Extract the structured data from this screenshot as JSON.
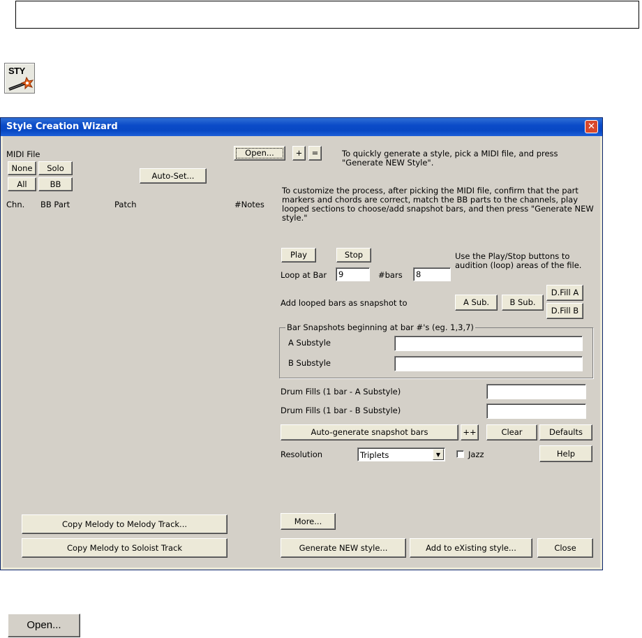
{
  "top_field": {
    "value": ""
  },
  "sty_button": {
    "label": "STY"
  },
  "window": {
    "title": "Style Creation Wizard",
    "close_glyph": "✕"
  },
  "left": {
    "midi_file_label": "MIDI File",
    "none_label": "None",
    "solo_label": "Solo",
    "all_label": "All",
    "bb_label": "BB",
    "auto_set_label": "Auto-Set...",
    "columns": [
      "Chn.",
      "BB Part",
      "Patch",
      "#Notes"
    ],
    "copy_melody_label": "Copy Melody to Melody Track...",
    "copy_soloist_label": "Copy Melody to Soloist Track"
  },
  "right": {
    "open_label": "Open...",
    "plus_label": "+",
    "equals_label": "=",
    "intro_text": "To quickly generate a style, pick a MIDI file, and press \"Generate NEW Style\".",
    "customize_text": "To customize the process, after picking the MIDI file, confirm that the part markers and chords are correct, match the BB parts to the channels, play looped sections to choose/add snapshot bars, and then press \"Generate NEW style.\"",
    "play_label": "Play",
    "stop_label": "Stop",
    "play_help": "Use the Play/Stop buttons to audition (loop) areas of the file.",
    "loop_at_bar_label": "Loop at Bar",
    "loop_at_bar_value": "9",
    "bars_label": "#bars",
    "bars_value": "8",
    "add_looped_label": "Add  looped bars as snapshot to",
    "a_sub_label": "A Sub.",
    "b_sub_label": "B Sub.",
    "dfill_a_label": "D.Fill A",
    "dfill_b_label": "D.Fill B",
    "snapshots_group_caption": "Bar Snapshots beginning at bar #'s (eg. 1,3,7)",
    "a_substyle_label": "A Substyle",
    "a_substyle_value": "",
    "b_substyle_label": "B Substyle",
    "b_substyle_value": "",
    "drum_fills_a_label": "Drum Fills (1 bar - A Substyle)",
    "drum_fills_a_value": "",
    "drum_fills_b_label": "Drum Fills (1 bar - B Substyle)",
    "drum_fills_b_value": "",
    "auto_generate_label": "Auto-generate snapshot bars",
    "plusplus_label": "++",
    "clear_label": "Clear",
    "defaults_label": "Defaults",
    "resolution_label": "Resolution",
    "resolution_value": "Triplets",
    "jazz_label": "Jazz",
    "help_label": "Help",
    "more_label": "More...",
    "generate_new_label": "Generate NEW style...",
    "add_existing_label": "Add to eXisting style...",
    "close_label": "Close"
  },
  "bottom_open_button": {
    "label": "Open..."
  }
}
